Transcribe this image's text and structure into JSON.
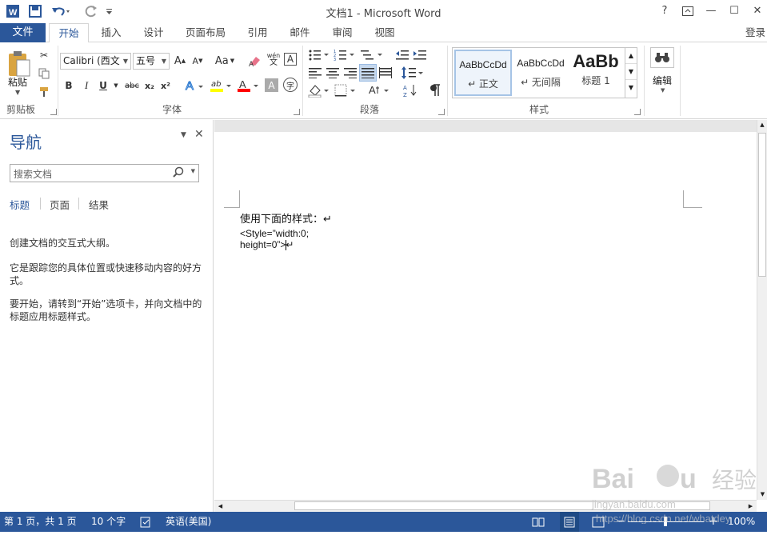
{
  "window": {
    "title": "文档1 - Microsoft Word",
    "controls": {
      "help": "?",
      "restore": "⧉",
      "minimize": "—",
      "maximize": "☐",
      "close": "✕"
    }
  },
  "quick_access": {
    "save": "save-icon",
    "undo": "undo-icon",
    "redo": "redo-icon",
    "customize": "customize-icon"
  },
  "tabs": {
    "file": "文件",
    "items": [
      "开始",
      "插入",
      "设计",
      "页面布局",
      "引用",
      "邮件",
      "审阅",
      "视图"
    ],
    "active": "开始",
    "login": "登录"
  },
  "ribbon": {
    "clipboard": {
      "paste": "粘贴",
      "label": "剪贴板"
    },
    "font": {
      "font_name": "Calibri (西文",
      "font_size": "五号",
      "label": "字体",
      "pinyin": "wén",
      "pinyin_char": "文",
      "aa_label": "Aa",
      "bold": "B",
      "italic": "I",
      "underline": "U",
      "strike": "abc",
      "sub": "x₂",
      "sup": "x²",
      "font_color": "A",
      "highlight": "ab"
    },
    "paragraph": {
      "label": "段落"
    },
    "styles": {
      "label": "样式",
      "items": [
        {
          "sample": "AaBbCcDd",
          "name": "↵ 正文"
        },
        {
          "sample": "AaBbCcDd",
          "name": "↵ 无间隔"
        },
        {
          "sample": "AaBb",
          "name": "标题 1"
        }
      ]
    },
    "editing": {
      "label": "编辑"
    }
  },
  "navigation": {
    "title": "导航",
    "search_placeholder": "搜索文档",
    "tabs": [
      "标题",
      "页面",
      "结果"
    ],
    "paragraphs": [
      "创建文档的交互式大纲。",
      "它是跟踪您的具体位置或快速移动内容的好方式。",
      "要开始，请转到“开始”选项卡，并向文档中的标题应用标题样式。"
    ]
  },
  "document": {
    "line1": "使用下面的样式：↵",
    "line2": "<Style=”width:0; height=0”>↵"
  },
  "statusbar": {
    "page": "第 1 页，共 1 页",
    "words": "10 个字",
    "language": "英语(美国)",
    "zoom": "100%"
  },
  "colors": {
    "accent": "#2b579a",
    "highlight": "#ffff00",
    "font_red": "#ff0000"
  }
}
